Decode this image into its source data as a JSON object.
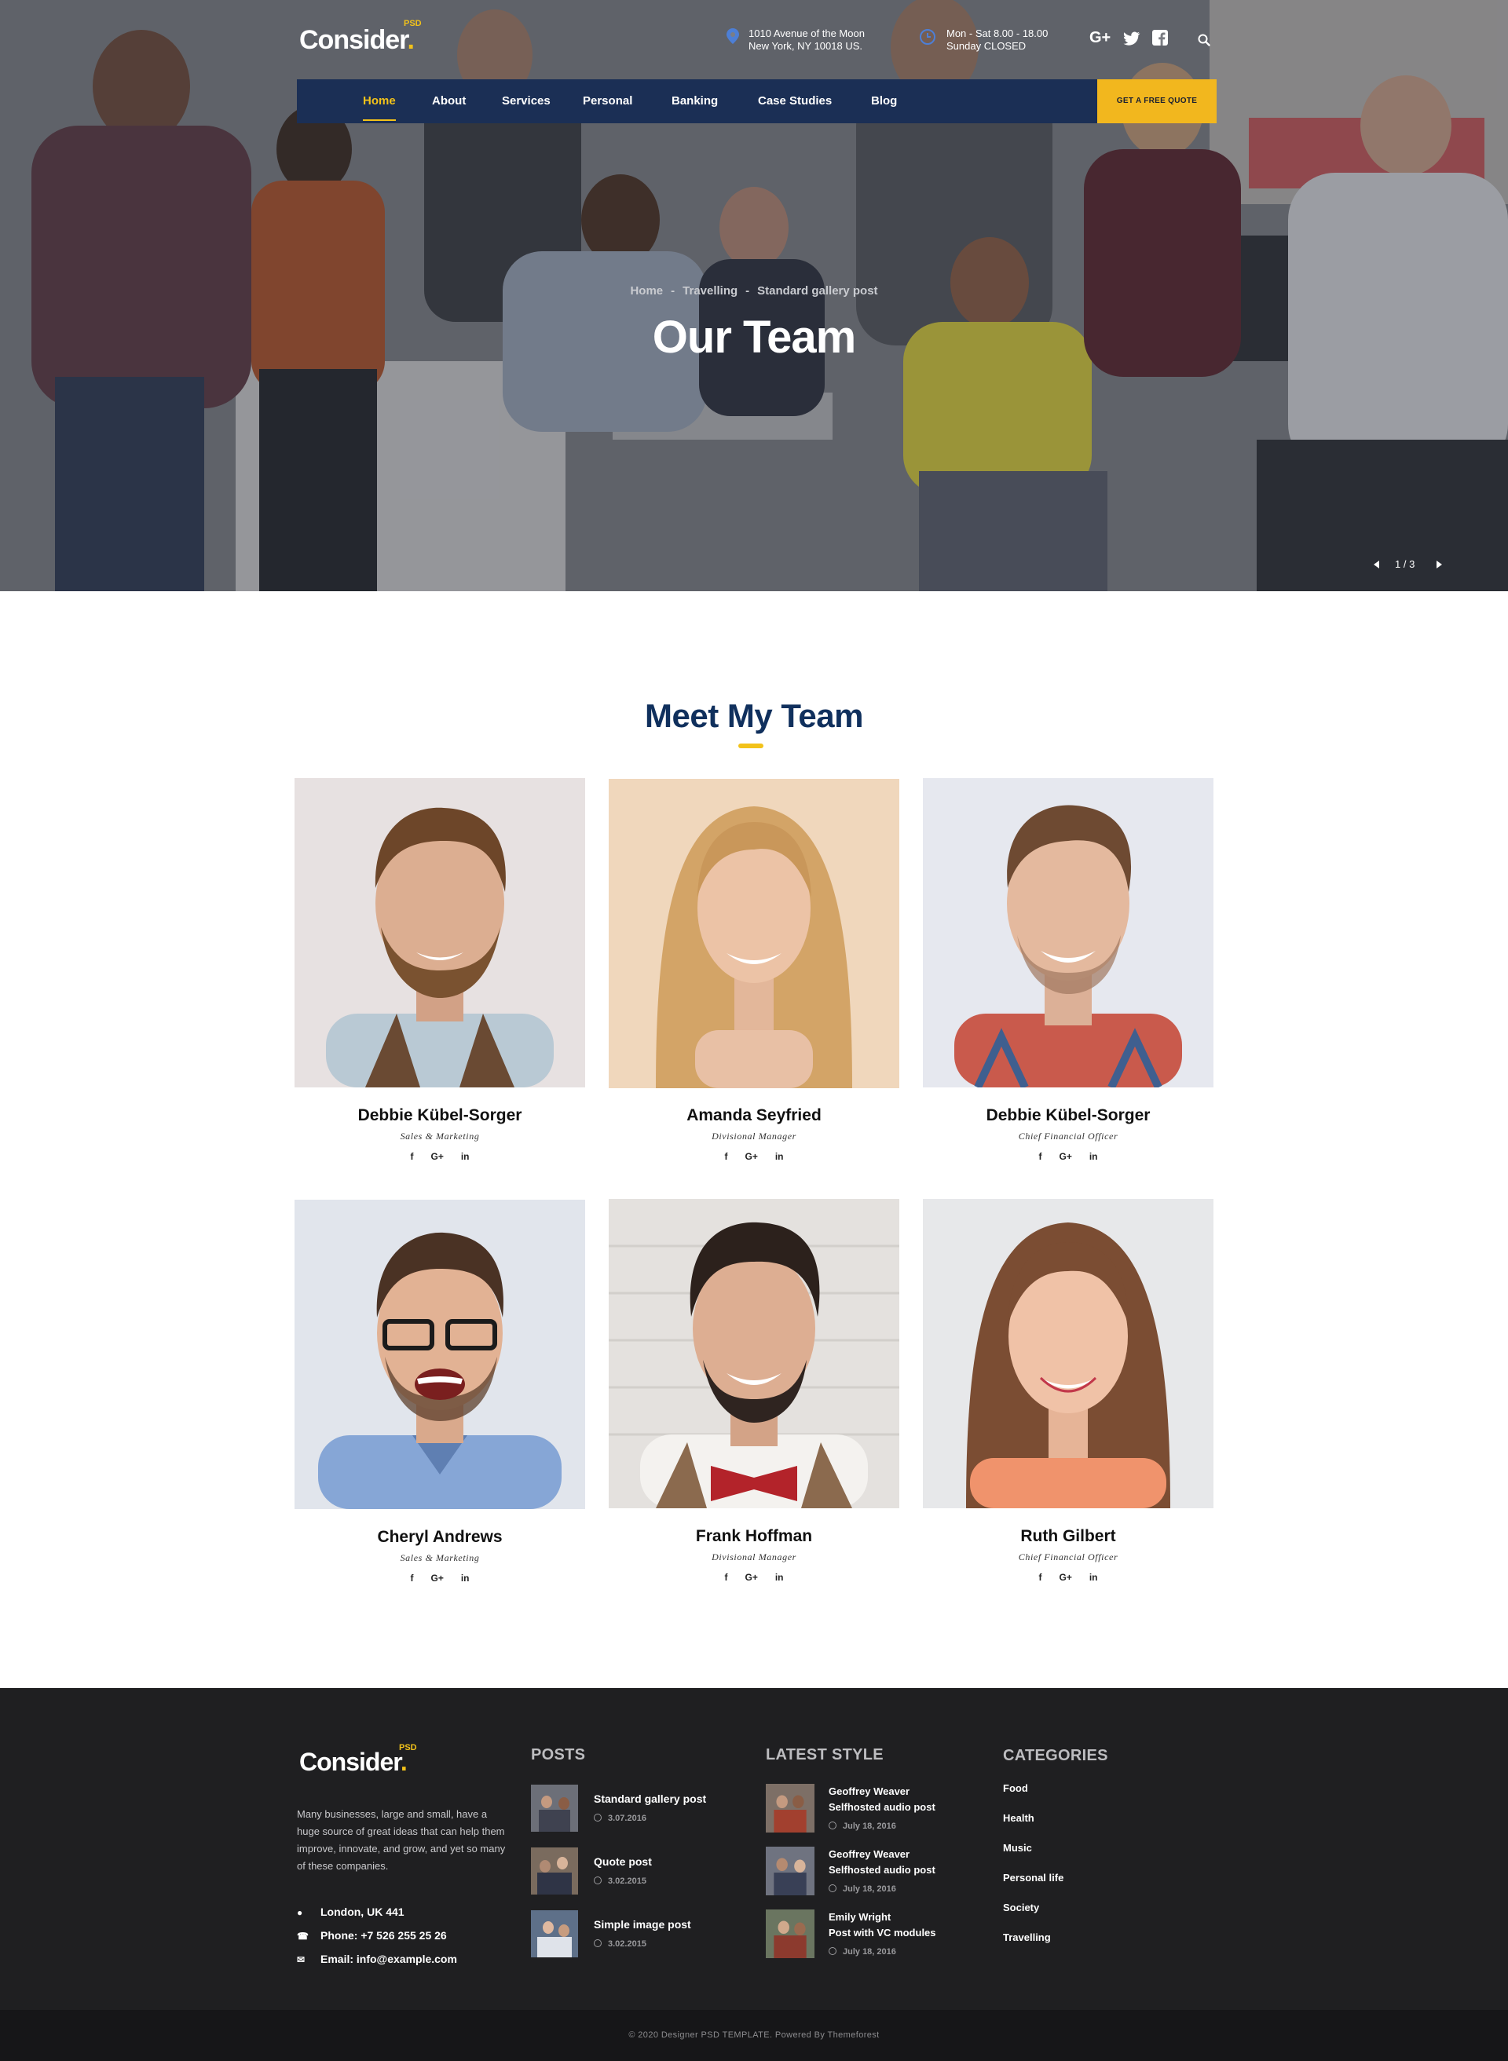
{
  "header": {
    "logo": {
      "text": "Consider",
      "dot": ".",
      "sup": "PSD"
    },
    "address": {
      "line1": "1010 Avenue of the Moon",
      "line2": "New York, NY 10018 US."
    },
    "hours": {
      "line1": "Mon - Sat 8.00 - 18.00",
      "line2": "Sunday CLOSED"
    },
    "social": {
      "gplus": "G+",
      "twitter": "twitter-icon",
      "facebook": "facebook-icon"
    },
    "search_icon": "search-icon",
    "nav": [
      "Home",
      "About",
      "Services",
      "Personal",
      "Banking",
      "Case Studies",
      "Blog"
    ],
    "quote_button": "GET A FREE QUOTE"
  },
  "hero": {
    "breadcrumb": [
      "Home",
      "Travelling",
      "Standard gallery post"
    ],
    "breadcrumb_sep": "-",
    "title": "Our Team",
    "slider": {
      "counter": "1 / 3"
    }
  },
  "team": {
    "title": "Meet My Team",
    "members": [
      {
        "name": "Debbie Kübel-Sorger",
        "role": "Sales & Marketing"
      },
      {
        "name": "Amanda Seyfried",
        "role": "Divisional Manager"
      },
      {
        "name": "Debbie Kübel-Sorger",
        "role": "Chief Financial Officer"
      },
      {
        "name": "Cheryl Andrews",
        "role": "Sales & Marketing"
      },
      {
        "name": "Frank Hoffman",
        "role": "Divisional Manager"
      },
      {
        "name": "Ruth Gilbert",
        "role": "Chief Financial Officer"
      }
    ],
    "social": {
      "f": "f",
      "g": "G+",
      "in": "in"
    }
  },
  "footer": {
    "logo": {
      "text": "Consider",
      "dot": ".",
      "sup": "PSD"
    },
    "about": "Many businesses, large and small, have a huge source of great ideas that can help them improve, innovate, and grow, and yet so many of these companies.",
    "contact": {
      "location": "London, UK 441",
      "phone": "Phone: +7 526 255 25 26",
      "email": "Email: info@example.com"
    },
    "posts": {
      "title": "POSTS",
      "items": [
        {
          "title": "Standard gallery post",
          "date": "3.07.2016"
        },
        {
          "title": "Quote post",
          "date": "3.02.2015"
        },
        {
          "title": "Simple image post",
          "date": "3.02.2015"
        }
      ]
    },
    "latest": {
      "title": "LATEST STYLE",
      "items": [
        {
          "author": "Geoffrey Weaver",
          "title": "Selfhosted audio post",
          "date": "July 18, 2016"
        },
        {
          "author": "Geoffrey Weaver",
          "title": "Selfhosted audio post",
          "date": "July 18, 2016"
        },
        {
          "author": "Emily Wright",
          "title": "Post with VC modules",
          "date": "July 18, 2016"
        }
      ]
    },
    "categories": {
      "title": "CATEGORIES",
      "items": [
        "Food",
        "Health",
        "Music",
        "Personal life",
        "Society",
        "Travelling"
      ]
    },
    "copyright": "© 2020 Designer PSD TEMPLATE. Powered By Themeforest"
  },
  "colors": {
    "navy": "#1b2f55",
    "accent": "#f2c21a",
    "title": "#10305d",
    "footer": "#1f1f21"
  }
}
